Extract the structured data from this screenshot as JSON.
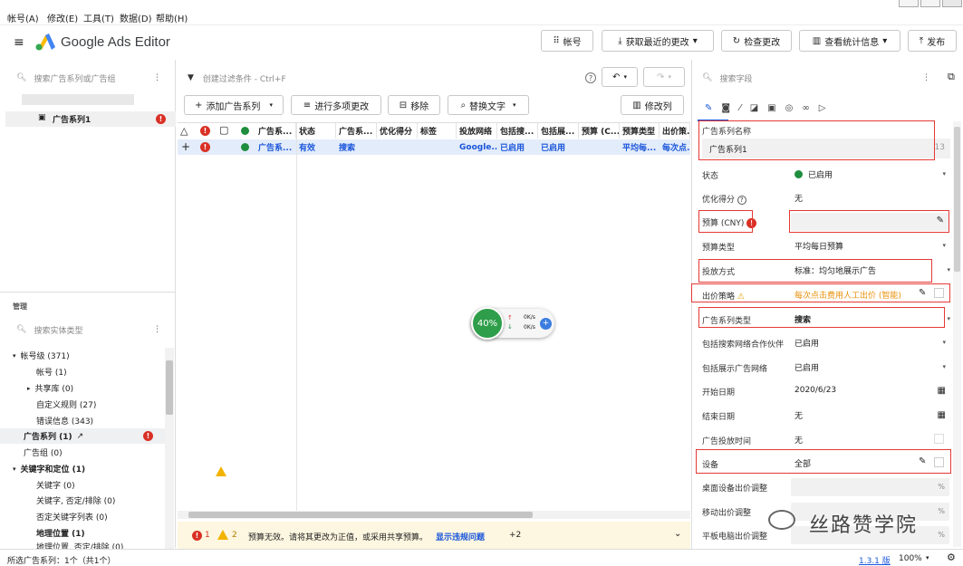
{
  "menu": {
    "account": "帐号(A)",
    "edit": "修改(E)",
    "tools": "工具(T)",
    "data": "数据(D)",
    "help": "帮助(H)"
  },
  "app": {
    "title": "Google Ads Editor"
  },
  "toolbar": {
    "account": "帐号",
    "get_changes": "获取最近的更改",
    "check": "检查更改",
    "stats": "查看统计信息",
    "publish": "发布"
  },
  "left": {
    "search_placeholder": "搜索广告系列或广告组",
    "campaign": "广告系列1",
    "manage": "管理",
    "entity_search": "搜索实体类型",
    "tree": [
      {
        "label": "帐号级 (371)"
      },
      {
        "label": "帐号 (1)"
      },
      {
        "label": "共享库 (0)"
      },
      {
        "label": "自定义规则 (27)"
      },
      {
        "label": "错误信息 (343)"
      },
      {
        "label": "广告系列 (1)"
      },
      {
        "label": "广告组 (0)"
      },
      {
        "label": "关键字和定位 (1)"
      },
      {
        "label": "关键字 (0)"
      },
      {
        "label": "关键字, 否定/排除 (0)"
      },
      {
        "label": "否定关键字列表 (0)"
      },
      {
        "label": "地理位置 (1)"
      },
      {
        "label": "地理位置, 否定/排除 (0)"
      }
    ]
  },
  "center": {
    "filter_placeholder": "创建过滤条件 - Ctrl+F",
    "add_campaign": "添加广告系列",
    "multi_edit": "进行多项更改",
    "remove": "移除",
    "replace": "替换文字",
    "edit_columns": "修改列",
    "headers": [
      "广告系...",
      "状态",
      "广告系...",
      "优化得分",
      "标签",
      "投放网络",
      "包括搜...",
      "包括展...",
      "预算 (C...",
      "预算类型",
      "出价策..."
    ],
    "row": [
      "广告系...",
      "有效",
      "搜索",
      "",
      "",
      "Google...",
      "已启用",
      "已启用",
      "",
      "平均每...",
      "每次点..."
    ],
    "bottom": {
      "err_count": "1",
      "warn_count": "2",
      "msg": "预算无效。请将其更改为正值，或采用共享预算。",
      "link": "显示违规问题",
      "more": "+2"
    },
    "speed": {
      "pct": "40%",
      "up": "0K/s",
      "down": "0K/s"
    }
  },
  "right": {
    "search_placeholder": "搜索字段",
    "fields": [
      {
        "label": "广告系列名称",
        "value": "广告系列1",
        "extra": "13"
      },
      {
        "label": "状态",
        "value": "已启用"
      },
      {
        "label": "优化得分",
        "value": "无"
      },
      {
        "label": "预算 (CNY)",
        "value": ""
      },
      {
        "label": "预算类型",
        "value": "平均每日预算"
      },
      {
        "label": "投放方式",
        "value": "标准：均匀地展示广告"
      },
      {
        "label": "出价策略",
        "value": "每次点击费用人工出价 (智能)"
      },
      {
        "label": "广告系列类型",
        "value": "搜索"
      },
      {
        "label": "包括搜索网络合作伙伴",
        "value": "已启用"
      },
      {
        "label": "包括展示广告网络",
        "value": "已启用"
      },
      {
        "label": "开始日期",
        "value": "2020/6/23"
      },
      {
        "label": "结束日期",
        "value": "无"
      },
      {
        "label": "广告投放时间",
        "value": "无"
      },
      {
        "label": "设备",
        "value": "全部"
      },
      {
        "label": "桌面设备出价调整",
        "value": "%"
      },
      {
        "label": "移动出价调整",
        "value": "%"
      },
      {
        "label": "平板电脑出价调整",
        "value": "%"
      }
    ]
  },
  "status": {
    "selected": "所选广告系列：1个（共1个）",
    "version": "1.3.1 版",
    "zoom": "100%"
  },
  "watermark": "丝路赞学院"
}
